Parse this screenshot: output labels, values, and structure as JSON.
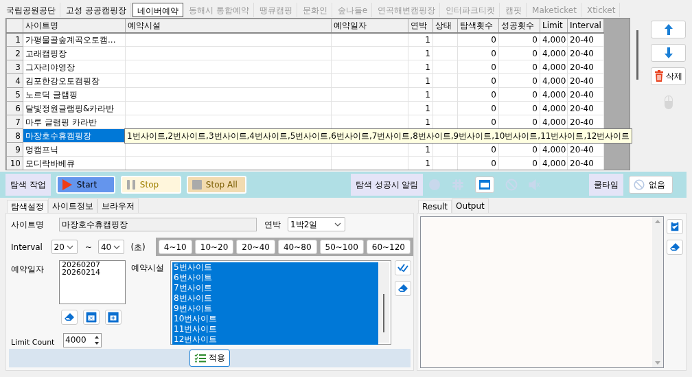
{
  "site_tabs": [
    {
      "label": "국립공원공단",
      "selected": false,
      "disabled": false
    },
    {
      "label": "고성 공공캠핑장",
      "selected": false,
      "disabled": false
    },
    {
      "label": "네이버예약",
      "selected": true,
      "disabled": false
    },
    {
      "label": "동해시 통합예약",
      "selected": false,
      "disabled": true
    },
    {
      "label": "땡큐캠핑",
      "selected": false,
      "disabled": true
    },
    {
      "label": "문화인",
      "selected": false,
      "disabled": true
    },
    {
      "label": "숲나들e",
      "selected": false,
      "disabled": true
    },
    {
      "label": "연곡해변캠핑장",
      "selected": false,
      "disabled": true
    },
    {
      "label": "인터파크티켓",
      "selected": false,
      "disabled": true
    },
    {
      "label": "캠핏",
      "selected": false,
      "disabled": true
    },
    {
      "label": "Maketicket",
      "selected": false,
      "disabled": true
    },
    {
      "label": "Xticket",
      "selected": false,
      "disabled": true
    }
  ],
  "grid": {
    "columns": [
      "사이트명",
      "예약시설",
      "예약일자",
      "연박",
      "상태",
      "탐색횟수",
      "성공횟수",
      "Limit",
      "Interval"
    ],
    "rows": [
      {
        "number": "1",
        "site": "가평물골숲계곡오토캠...",
        "nights": "1",
        "searches": "0",
        "successes": "0",
        "limit": "4,000",
        "interval": "20-40",
        "selected": false
      },
      {
        "number": "2",
        "site": "고래캠핑장",
        "nights": "1",
        "searches": "0",
        "successes": "0",
        "limit": "4,000",
        "interval": "20-40",
        "selected": false
      },
      {
        "number": "3",
        "site": "그자리야영장",
        "nights": "1",
        "searches": "0",
        "successes": "0",
        "limit": "4,000",
        "interval": "20-40",
        "selected": false
      },
      {
        "number": "4",
        "site": "김포한강오토캠핑장",
        "nights": "1",
        "searches": "0",
        "successes": "0",
        "limit": "4,000",
        "interval": "20-40",
        "selected": false
      },
      {
        "number": "5",
        "site": "노르딕 글램핑",
        "nights": "1",
        "searches": "0",
        "successes": "0",
        "limit": "4,000",
        "interval": "20-40",
        "selected": false
      },
      {
        "number": "6",
        "site": "달빛정원글램핑&카라반",
        "nights": "1",
        "searches": "0",
        "successes": "0",
        "limit": "4,000",
        "interval": "20-40",
        "selected": false
      },
      {
        "number": "7",
        "site": "마루 글램핑 카라반",
        "nights": "1",
        "searches": "0",
        "successes": "0",
        "limit": "4,000",
        "interval": "20-40",
        "selected": false
      },
      {
        "number": "8",
        "site": "마장호수휴캠핑장",
        "selected": true
      },
      {
        "number": "9",
        "site": "멍캠프닉",
        "nights": "1",
        "searches": "0",
        "successes": "0",
        "limit": "4,000",
        "interval": "20-40",
        "selected": false
      },
      {
        "number": "10",
        "site": "모디락바베큐",
        "nights": "1",
        "searches": "0",
        "successes": "0",
        "limit": "4,000",
        "interval": "20-40",
        "selected": false
      }
    ],
    "tooltip": "1번사이트,2번사이트,3번사이트,4번사이트,5번사이트,6번사이트,7번사이트,8번사이트,9번사이트,10번사이트,11번사이트,12번사이트"
  },
  "side_buttons": [
    {
      "kind": "up"
    },
    {
      "kind": "down"
    },
    {
      "kind": "delete",
      "label": "삭제"
    },
    {
      "kind": "mouse"
    }
  ],
  "toolbar": {
    "task_label": "탐색 작업",
    "start": "Start",
    "stop": "Stop",
    "stop_all": "Stop All",
    "alert_label": "탐색 성공시 알림",
    "alert_icons": [
      {
        "kind": "telegram",
        "on": false
      },
      {
        "kind": "slack",
        "on": false
      },
      {
        "kind": "window",
        "on": true
      },
      {
        "kind": "block",
        "on": false
      },
      {
        "kind": "mute",
        "on": false
      }
    ],
    "cooldown_label": "쿨타임",
    "cooldown_button": "없음"
  },
  "settings": {
    "tabs": [
      {
        "label": "탐색설정",
        "selected": true
      },
      {
        "label": "사이트정보",
        "selected": false
      },
      {
        "label": "브라우저",
        "selected": false
      }
    ],
    "site_name_label": "사이트명",
    "site_name": "마장호수휴캠핑장",
    "nights_label": "연박",
    "nights": "1박2일",
    "interval_label": "Interval",
    "interval_from": "20",
    "interval_tilde": "~",
    "interval_to": "40",
    "unit": "(초)",
    "presets": [
      "4~10",
      "10~20",
      "20~40",
      "40~80",
      "50~100",
      "60~120"
    ],
    "dates_label": "예약일자",
    "dates": [
      "20260207",
      "20260214"
    ],
    "facilities_label": "예약시설",
    "facilities": [
      {
        "label": "5번사이트",
        "selected": true
      },
      {
        "label": "6번사이트",
        "selected": true
      },
      {
        "label": "7번사이트",
        "selected": true
      },
      {
        "label": "8번사이트",
        "selected": true
      },
      {
        "label": "9번사이트",
        "selected": true
      },
      {
        "label": "10번사이트",
        "selected": true
      },
      {
        "label": "11번사이트",
        "selected": true
      },
      {
        "label": "12번사이트",
        "selected": true
      }
    ],
    "limit_label": "Limit Count",
    "limit": "4000",
    "apply": "적용"
  },
  "output": {
    "tabs": [
      {
        "label": "Result",
        "selected": true
      },
      {
        "label": "Output",
        "selected": false
      }
    ]
  }
}
